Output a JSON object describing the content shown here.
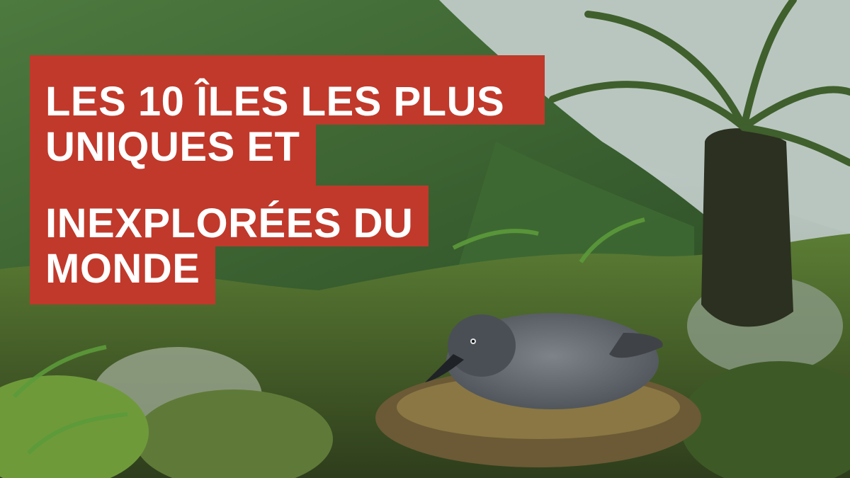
{
  "title": {
    "line1": "LES 10 ÎLES LES PLUS",
    "line2": "UNIQUES ET",
    "line3": "INEXPLORÉES DU",
    "line4": "MONDE"
  },
  "colors": {
    "banner": "#c0392b",
    "text": "#ffffff"
  }
}
